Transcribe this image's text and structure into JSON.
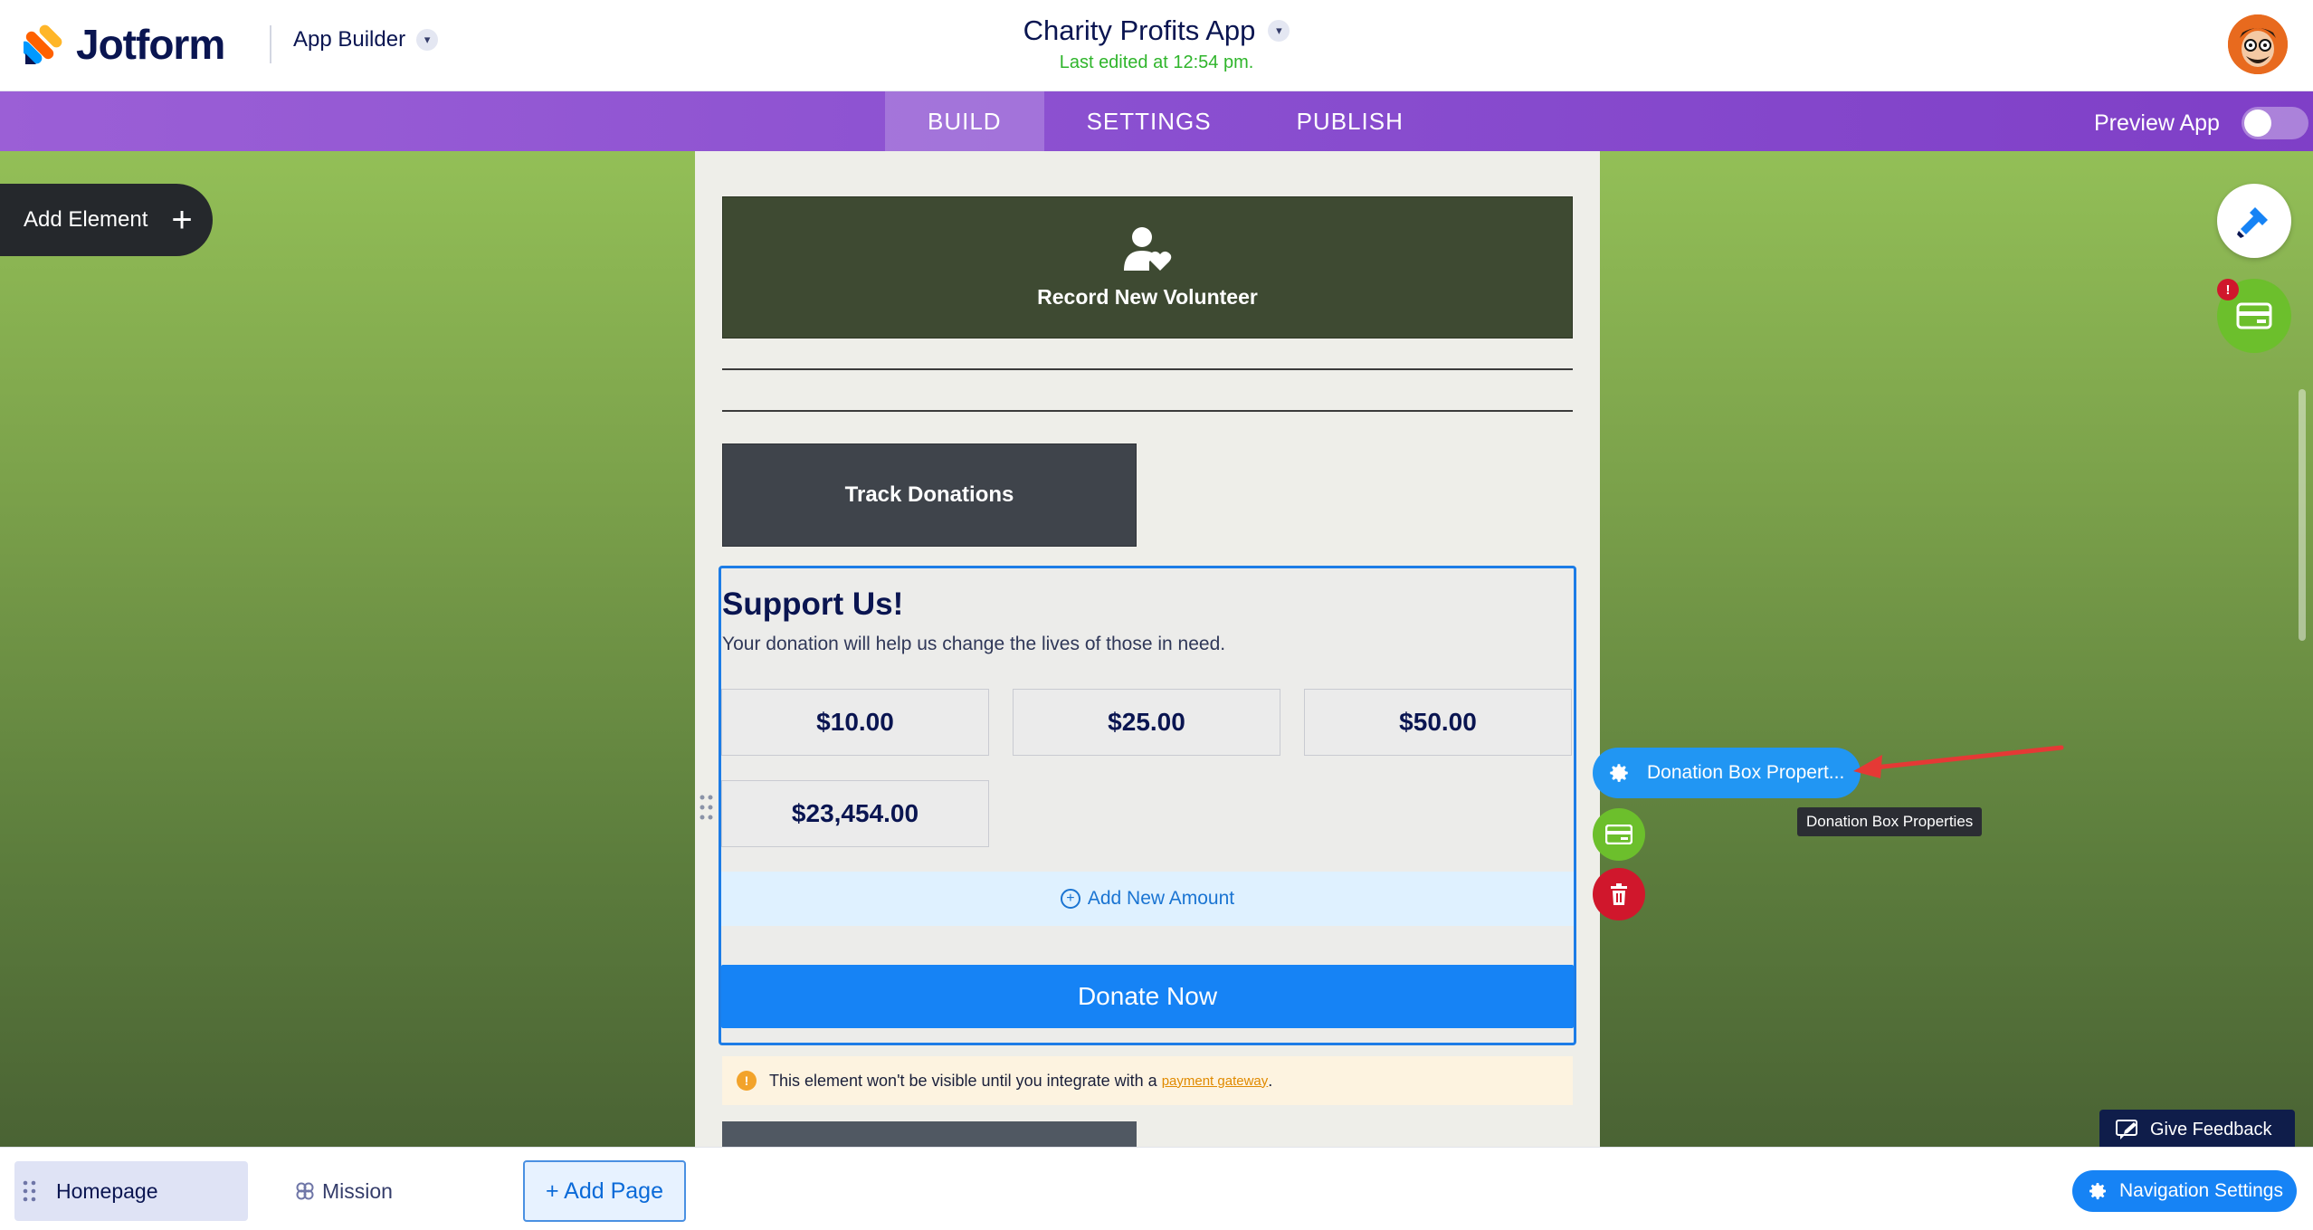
{
  "header": {
    "brand": "Jotform",
    "builder_label": "App Builder",
    "app_title": "Charity Profits App",
    "last_edited": "Last edited at 12:54 pm."
  },
  "tabs": [
    {
      "label": "BUILD",
      "active": true
    },
    {
      "label": "SETTINGS",
      "active": false
    },
    {
      "label": "PUBLISH",
      "active": false
    }
  ],
  "preview": {
    "label": "Preview App",
    "enabled": false
  },
  "toolbar": {
    "add_element": "Add Element"
  },
  "page": {
    "volunteer_button": "Record New Volunteer",
    "track_button": "Track Donations",
    "donation": {
      "title": "Support Us!",
      "subtitle": "Your donation will help us change the lives of those in need.",
      "amounts": [
        "$10.00",
        "$25.00",
        "$50.00",
        "$23,454.00"
      ],
      "add_amount": "Add New Amount",
      "donate_label": "Donate Now"
    },
    "warning": {
      "text": "This element won't be visible until you integrate with a",
      "link": "payment gateway",
      "suffix": "."
    }
  },
  "element_tools": {
    "properties_label": "Donation Box Propert...",
    "tooltip": "Donation Box Properties"
  },
  "right_panel": {
    "badge": "!"
  },
  "feedback": "Give Feedback",
  "bottom": {
    "pages": [
      "Homepage",
      "Mission"
    ],
    "add_page": "+ Add Page",
    "nav_settings": "Navigation Settings"
  },
  "colors": {
    "accent_purple": "#8a4fd0",
    "primary_blue": "#1683f5",
    "success_green": "#2fb52b",
    "danger_red": "#d0172c"
  }
}
